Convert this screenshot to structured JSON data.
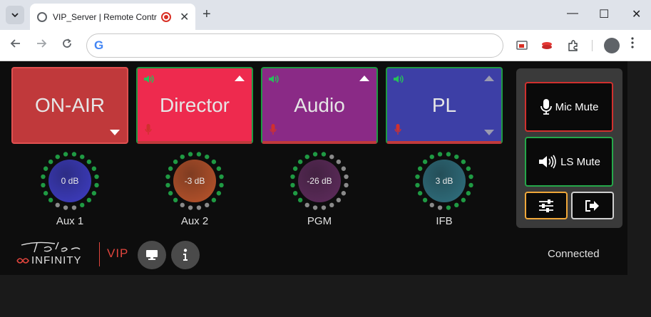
{
  "browser": {
    "tab_title": "VIP_Server | Remote Control",
    "new_tab_symbol": "+",
    "tab_close_symbol": "✕",
    "omnibox_value": "",
    "window_controls": {
      "minimize": "—",
      "maximize": "☐",
      "close": "✕"
    }
  },
  "sources": [
    {
      "label": "ON-AIR",
      "bg": "#c0393b",
      "arrow": "down",
      "speaker": false,
      "mic": false,
      "top_border": "#c0393b",
      "bottom_border": "#c0393b",
      "frame": "#e05050"
    },
    {
      "label": "Director",
      "bg": "#ee2a4e",
      "arrow": "up",
      "speaker": true,
      "mic": true,
      "top_border": "#1f9a43",
      "bottom_border": "#c0393b"
    },
    {
      "label": "Audio",
      "bg": "#8a2a86",
      "arrow": "up",
      "speaker": true,
      "mic": true,
      "top_border": "#1f9a43",
      "bottom_border": "#c0393b"
    },
    {
      "label": "PL",
      "bg": "#3d3fa6",
      "arrow": "both",
      "speaker": true,
      "mic": true,
      "top_border": "#1f9a43",
      "bottom_border": "#c0393b"
    }
  ],
  "knobs": [
    {
      "label": "Aux 1",
      "value": "0 dB",
      "color": "#3b3ab8",
      "level": 0.85
    },
    {
      "label": "Aux 2",
      "value": "-3 dB",
      "color": "#b0502a",
      "level": 0.78
    },
    {
      "label": "PGM",
      "value": "-26 dB",
      "color": "#5a2a58",
      "level": 0.45
    },
    {
      "label": "IFB",
      "value": "3 dB",
      "color": "#2e6a78",
      "level": 0.92
    }
  ],
  "panel": {
    "mic_mute_label": "Mic Mute",
    "ls_mute_label": "LS Mute",
    "mic_mute_border": "#d0302e",
    "ls_mute_border": "#25a84a",
    "settings_border": "#f0a83a"
  },
  "footer": {
    "vip_label": "VIP",
    "status": "Connected"
  },
  "colors": {
    "accent_red": "#e0453d",
    "green_dot": "#1f9a43",
    "grey_dot": "#8a8a8a"
  }
}
